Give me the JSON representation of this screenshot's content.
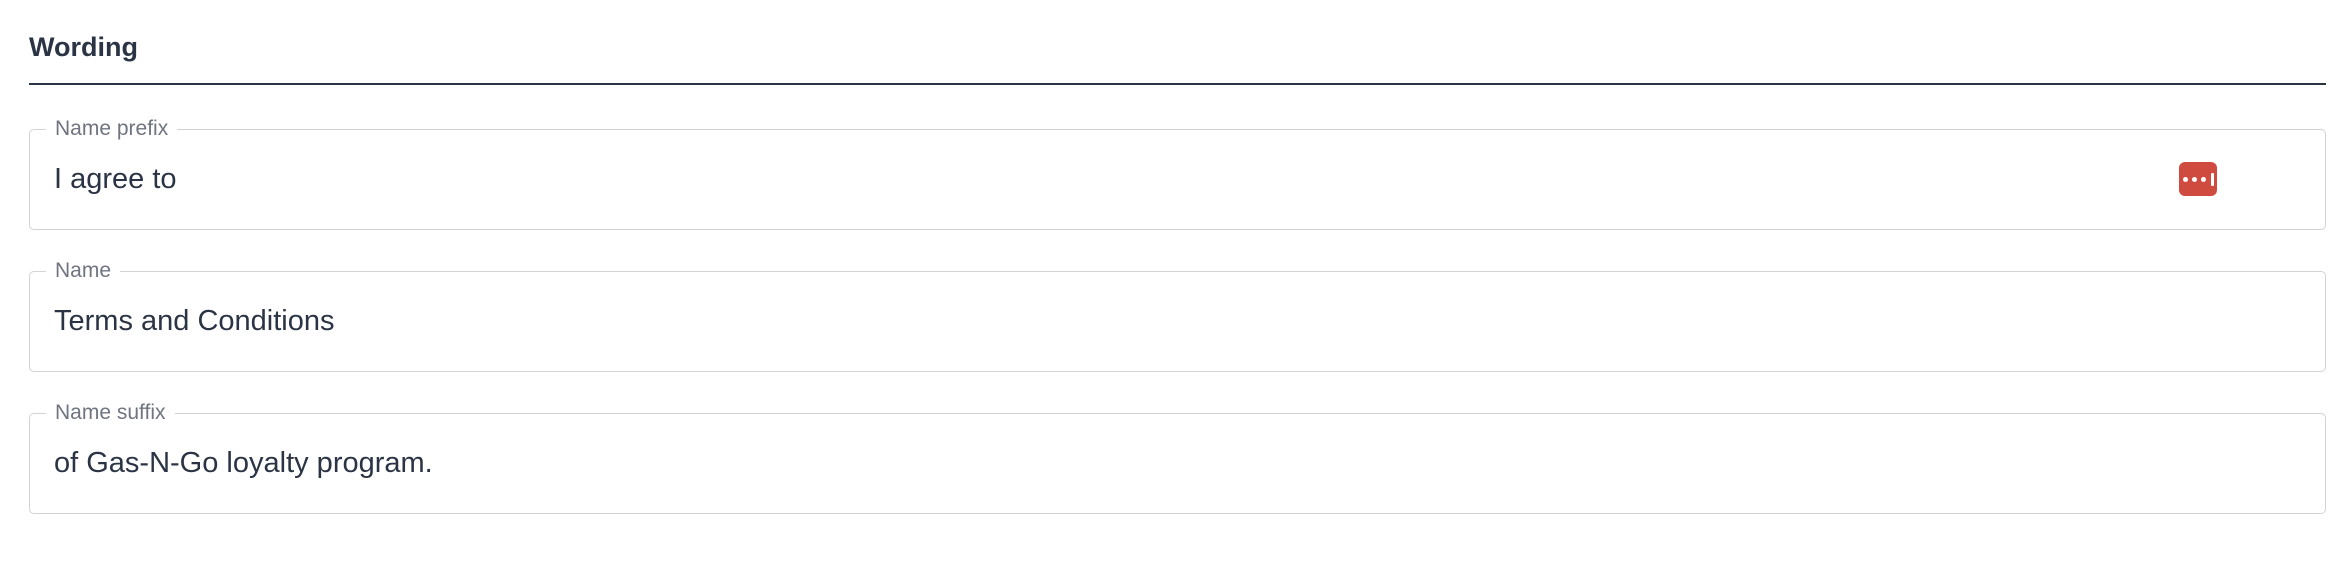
{
  "section": {
    "title": "Wording"
  },
  "fields": [
    {
      "label": "Name prefix",
      "value": "I agree to",
      "has_password_manager_icon": true
    },
    {
      "label": "Name",
      "value": "Terms and Conditions"
    },
    {
      "label": "Name suffix",
      "value": "of Gas-N-Go loyalty program."
    }
  ],
  "password_manager_icon": {
    "icon": "password-manager-icon",
    "color": "#cf4a3f"
  }
}
